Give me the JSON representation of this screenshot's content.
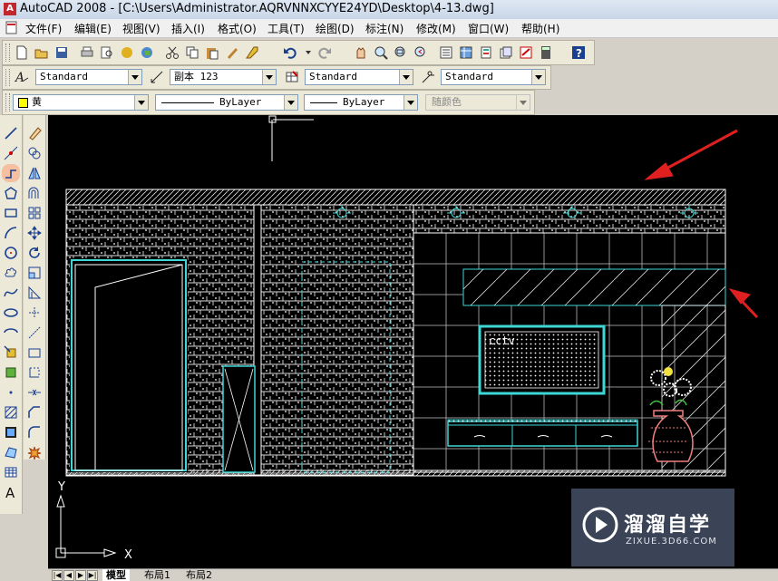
{
  "window": {
    "app_icon": "autocad-icon",
    "title": "AutoCAD 2008 - [C:\\Users\\Administrator.AQRVNNXCYYE24YD\\Desktop\\4-13.dwg]"
  },
  "menu": [
    "文件(F)",
    "编辑(E)",
    "视图(V)",
    "插入(I)",
    "格式(O)",
    "工具(T)",
    "绘图(D)",
    "标注(N)",
    "修改(M)",
    "窗口(W)",
    "帮助(H)"
  ],
  "styles_toolbar": {
    "text_style": "Standard",
    "dim_style": "副本 123",
    "table_style": "Standard",
    "multileader_style": "Standard"
  },
  "layers_toolbar": {
    "layer": "黄",
    "linetype": "ByLayer",
    "lineweight": "ByLayer",
    "plot_style": "随颜色"
  },
  "drawing": {
    "tv_label": "cctv",
    "ucs_y": "Y",
    "ucs_x": "X",
    "colors": {
      "cyan": "#3fd6d6",
      "white": "#ffffff",
      "red": "#e02020",
      "pink": "#f08080",
      "yellow": "#f0e040"
    }
  },
  "layout_tabs": [
    "模型",
    "布局1",
    "布局2"
  ],
  "watermark": {
    "brand": "溜溜自学",
    "url": "ZIXUE.3D66.COM"
  }
}
